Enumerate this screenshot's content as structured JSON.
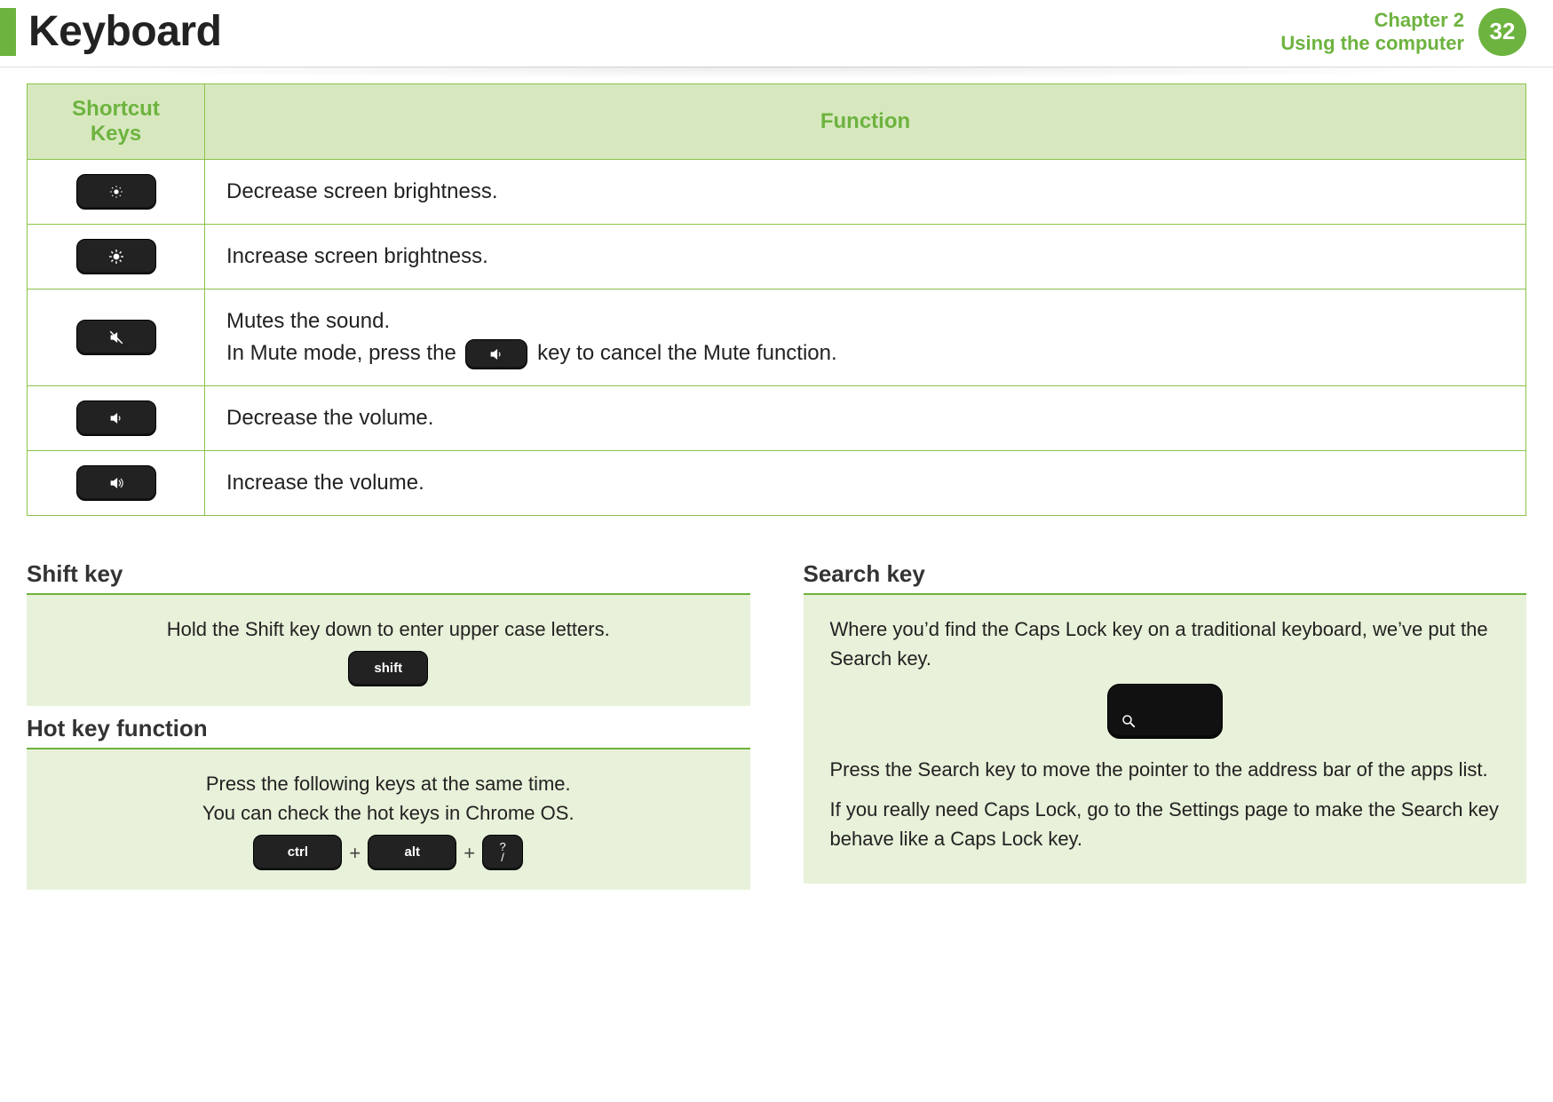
{
  "header": {
    "title": "Keyboard",
    "chapter_line1": "Chapter 2",
    "chapter_line2": "Using the computer",
    "page_number": "32"
  },
  "table": {
    "head_col1": "Shortcut Keys",
    "head_col2": "Function",
    "rows": [
      {
        "key_icon": "brightness-low-icon",
        "function": "Decrease screen brightness."
      },
      {
        "key_icon": "brightness-high-icon",
        "function": "Increase screen brightness."
      },
      {
        "key_icon": "mute-icon",
        "function_prefix": "Mutes the sound.",
        "function_line2a": "In Mute mode, press the",
        "function_line2b": "key to cancel the Mute function.",
        "inline_key_icon": "volume-down-icon"
      },
      {
        "key_icon": "volume-down-icon",
        "function": "Decrease the volume."
      },
      {
        "key_icon": "volume-up-icon",
        "function": "Increase the volume."
      }
    ]
  },
  "shift_section": {
    "heading": "Shift key",
    "text": "Hold the Shift key down to enter upper case letters.",
    "key_label": "shift"
  },
  "hotkey_section": {
    "heading": "Hot key function",
    "line1": "Press the following keys at the same time.",
    "line2": "You can check the hot keys in Chrome OS.",
    "key_ctrl": "ctrl",
    "key_alt": "alt",
    "key_q_top": "?",
    "key_q_bot": "/",
    "plus": "+"
  },
  "search_section": {
    "heading": "Search key",
    "p1": "Where you’d find the Caps Lock key on a traditional keyboard, we’ve put the Search key.",
    "p2": "Press the Search key to move the pointer to the address bar of the apps list.",
    "p3": "If you really need Caps Lock, go to the Settings page to make the Search key behave like a Caps Lock key."
  }
}
